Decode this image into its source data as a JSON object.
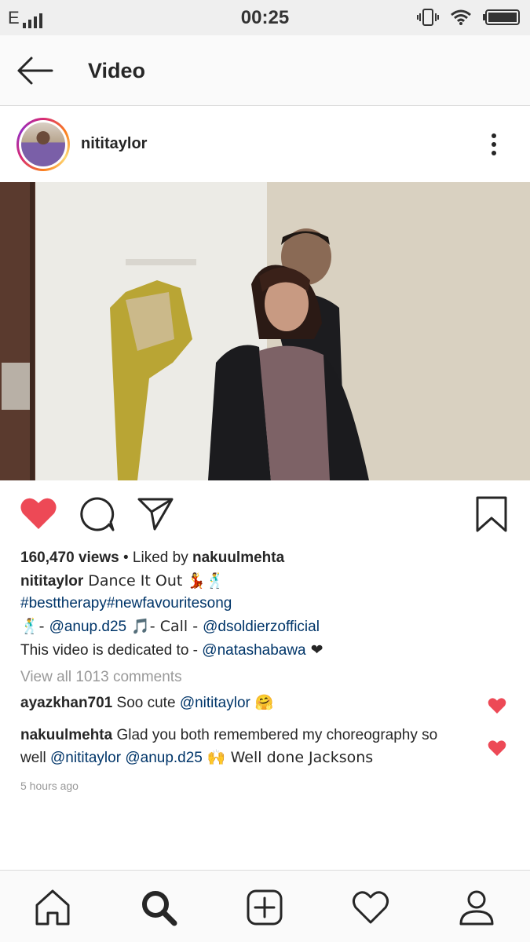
{
  "status_bar": {
    "carrier": "E",
    "time": "00:25"
  },
  "header": {
    "title": "Video",
    "back_icon": "arrow-left-icon"
  },
  "post": {
    "username": "nititaylor",
    "more_icon": "more-vertical-icon",
    "liked": true,
    "views": "160,470 views",
    "liked_by_prefix": " • Liked by ",
    "liked_by_user": "nakuulmehta",
    "caption_user": "nititaylor",
    "caption_lines": [
      {
        "text": " Dance It Out 💃🕺"
      },
      {
        "hashtags": "#besttherapy#newfavouritesong"
      },
      {
        "pre": "🕺- ",
        "mention1": "@anup.d25",
        "mid": " 🎵- Call - ",
        "mention2": "@dsoldierzofficial"
      },
      {
        "pre": "This video is dedicated to - ",
        "mention": "@natashabawa",
        "post": " ❤"
      }
    ],
    "view_all_comments": "View all 1013 comments",
    "comments": [
      {
        "user": "ayazkhan701",
        "text": " Soo cute ",
        "mention": "@nititaylor",
        "emoji": " 🤗",
        "liked": true
      },
      {
        "user": "nakuulmehta",
        "text1": " Glad you both remembered my choreography so",
        "text2": "well ",
        "mention1": "@nititaylor",
        "mention2": " @anup.d25",
        "rest": " 🙌 Well done Jacksons",
        "liked": true
      }
    ],
    "timestamp": "5 hours ago"
  },
  "colors": {
    "like_red": "#ed4956",
    "link_blue": "#003569",
    "muted_gray": "#999999"
  },
  "bottom_nav": [
    "home-icon",
    "search-icon",
    "add-post-icon",
    "activity-heart-icon",
    "profile-icon"
  ]
}
